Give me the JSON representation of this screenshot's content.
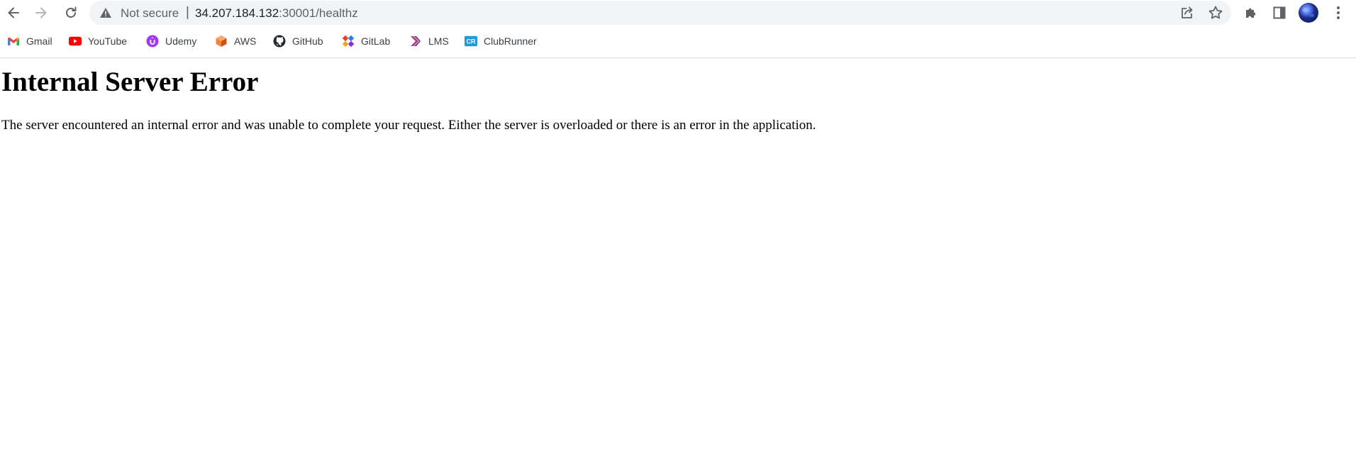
{
  "browser": {
    "omnibox": {
      "security_status": "Not secure",
      "separator": "|",
      "url_host": "34.207.184.132",
      "url_path": ":30001/healthz"
    },
    "icons": {
      "back": "back-arrow-icon",
      "forward": "forward-arrow-icon",
      "reload": "reload-icon",
      "warning": "warning-triangle-icon",
      "share": "share-icon",
      "bookmark_star": "star-icon",
      "extensions": "puzzle-piece-icon",
      "side_panel": "side-panel-icon",
      "profile": "avatar",
      "menu": "vertical-dots-icon"
    }
  },
  "bookmarks": [
    {
      "label": "Gmail",
      "icon": "gmail-icon"
    },
    {
      "label": "YouTube",
      "icon": "youtube-icon"
    },
    {
      "label": "Udemy",
      "icon": "udemy-icon"
    },
    {
      "label": "AWS",
      "icon": "aws-icon"
    },
    {
      "label": "GitHub",
      "icon": "github-icon"
    },
    {
      "label": "GitLab",
      "icon": "gitlab-icon"
    },
    {
      "label": "LMS",
      "icon": "lms-icon"
    },
    {
      "label": "ClubRunner",
      "icon": "clubrunner-icon"
    }
  ],
  "page": {
    "title": "Internal Server Error",
    "message": "The server encountered an internal error and was unable to complete your request. Either the server is overloaded or there is an error in the application."
  },
  "colors": {
    "omnibox_bg": "#f1f3f4",
    "text_muted": "#5f6368",
    "youtube_red": "#ff0000",
    "udemy_purple": "#a435f0",
    "aws_orange": "#f58534",
    "clubrunner_blue": "#1e9bd7"
  }
}
